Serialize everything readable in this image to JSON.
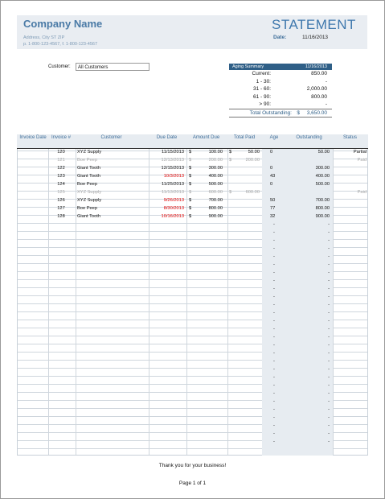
{
  "header": {
    "company_name": "Company Name",
    "address_line": "Address, City ST ZIP",
    "phone_line": "p. 1-800-123-4567, f. 1-800-123-4567",
    "statement_title": "STATEMENT",
    "date_label": "Date:",
    "date_value": "11/16/2013"
  },
  "customer": {
    "label": "Customer:",
    "value": "All Customers"
  },
  "aging_summary": {
    "title": "Aging Summary",
    "date": "11/16/2013",
    "rows": [
      {
        "label": "Current:",
        "value": "850.00"
      },
      {
        "label": "1 - 30:",
        "value": "-"
      },
      {
        "label": "31 - 60:",
        "value": "2,000.00"
      },
      {
        "label": "61 - 90:",
        "value": "800.00"
      },
      {
        "label": "> 90:",
        "value": "-"
      }
    ],
    "total_label": "Total Outstanding:",
    "total_currency": "$",
    "total_value": "3,650.00"
  },
  "table": {
    "columns": [
      "Invoice Date",
      "Invoice #",
      "Customer",
      "Due Date",
      "Amount Due",
      "Total Paid",
      "Age",
      "Outstanding",
      "Status"
    ],
    "rows": [
      {
        "invoice": "120",
        "customer": "XYZ Supply",
        "due": "11/15/2013",
        "amount": "100.00",
        "paid": "50.00",
        "age": "0",
        "outstanding": "50.00",
        "status": "Partial",
        "style": "normal",
        "due_red": false
      },
      {
        "invoice": "121",
        "customer": "Boe Peep",
        "due": "12/13/2013",
        "amount": "200.00",
        "paid": "200.00",
        "age": "",
        "outstanding": "",
        "status": "Paid",
        "style": "grey",
        "due_red": false
      },
      {
        "invoice": "122",
        "customer": "Giant Tooth",
        "due": "12/15/2013",
        "amount": "300.00",
        "paid": "",
        "age": "0",
        "outstanding": "300.00",
        "status": "",
        "style": "normal",
        "due_red": false
      },
      {
        "invoice": "123",
        "customer": "Giant Tooth",
        "due": "10/3/2013",
        "amount": "400.00",
        "paid": "",
        "age": "43",
        "outstanding": "400.00",
        "status": "",
        "style": "normal",
        "due_red": true
      },
      {
        "invoice": "124",
        "customer": "Boe Peep",
        "due": "11/25/2013",
        "amount": "500.00",
        "paid": "",
        "age": "0",
        "outstanding": "500.00",
        "status": "",
        "style": "normal",
        "due_red": false
      },
      {
        "invoice": "125",
        "customer": "XYZ Supply",
        "due": "11/13/2013",
        "amount": "600.00",
        "paid": "600.00",
        "age": "",
        "outstanding": "",
        "status": "Paid",
        "style": "grey",
        "due_red": false
      },
      {
        "invoice": "126",
        "customer": "XYZ Supply",
        "due": "9/26/2013",
        "amount": "700.00",
        "paid": "",
        "age": "50",
        "outstanding": "700.00",
        "status": "",
        "style": "normal",
        "due_red": true
      },
      {
        "invoice": "127",
        "customer": "Boe Peep",
        "due": "8/30/2013",
        "amount": "800.00",
        "paid": "",
        "age": "77",
        "outstanding": "800.00",
        "status": "",
        "style": "normal",
        "due_red": true
      },
      {
        "invoice": "128",
        "customer": "Giant Tooth",
        "due": "10/16/2013",
        "amount": "900.00",
        "paid": "",
        "age": "32",
        "outstanding": "900.00",
        "status": "",
        "style": "normal",
        "due_red": true
      }
    ],
    "currency_symbol": "$",
    "empty_row_count": 28,
    "empty_age": "-",
    "empty_outstanding": "-"
  },
  "footer": {
    "thanks": "Thank you for your business!",
    "page": "Page 1 of 1"
  },
  "colors": {
    "accent": "#3f78ad",
    "aging_header_bg": "#2f5f87",
    "overdue_red": "#e00000",
    "paid_grey": "#a8a8a8"
  }
}
